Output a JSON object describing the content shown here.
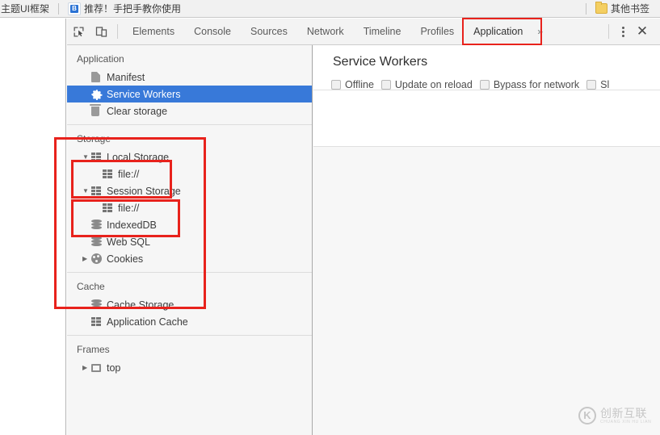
{
  "browser": {
    "bookmarks": [
      {
        "label": "主题UI框架",
        "icon": "none"
      },
      {
        "label": "推荐！手把手教你使用",
        "icon": "favicon-b"
      }
    ],
    "other_bookmarks_label": "其他书签",
    "folder_icon": "folder-icon"
  },
  "devtools": {
    "toolbar": {
      "inspect_icon": "inspect-element-icon",
      "device_icon": "device-toolbar-icon",
      "tabs": [
        {
          "label": "Elements",
          "active": false
        },
        {
          "label": "Console",
          "active": false
        },
        {
          "label": "Sources",
          "active": false
        },
        {
          "label": "Network",
          "active": false
        },
        {
          "label": "Timeline",
          "active": false
        },
        {
          "label": "Profiles",
          "active": false
        },
        {
          "label": "Application",
          "active": true
        }
      ],
      "overflow_label": "»",
      "more_icon": "kebab-menu-icon",
      "close_icon": "close-icon"
    },
    "sidebar": {
      "sections": [
        {
          "title": "Application",
          "items": [
            {
              "label": "Manifest",
              "icon": "document-icon",
              "arrow": "none",
              "indent": 1,
              "selected": false
            },
            {
              "label": "Service Workers",
              "icon": "gear-icon",
              "arrow": "none",
              "indent": 1,
              "selected": true
            },
            {
              "label": "Clear storage",
              "icon": "trash-icon",
              "arrow": "none",
              "indent": 1,
              "selected": false
            }
          ]
        },
        {
          "title": "Storage",
          "items": [
            {
              "label": "Local Storage",
              "icon": "table-icon",
              "arrow": "expanded",
              "indent": 1,
              "selected": false
            },
            {
              "label": "file://",
              "icon": "table-icon",
              "arrow": "none",
              "indent": 2,
              "selected": false
            },
            {
              "label": "Session Storage",
              "icon": "table-icon",
              "arrow": "expanded",
              "indent": 1,
              "selected": false
            },
            {
              "label": "file://",
              "icon": "table-icon",
              "arrow": "none",
              "indent": 2,
              "selected": false
            },
            {
              "label": "IndexedDB",
              "icon": "database-icon",
              "arrow": "none",
              "indent": 1,
              "selected": false
            },
            {
              "label": "Web SQL",
              "icon": "database-icon",
              "arrow": "none",
              "indent": 1,
              "selected": false
            },
            {
              "label": "Cookies",
              "icon": "cookie-icon",
              "arrow": "collapsed",
              "indent": 1,
              "selected": false
            }
          ]
        },
        {
          "title": "Cache",
          "items": [
            {
              "label": "Cache Storage",
              "icon": "database-icon",
              "arrow": "none",
              "indent": 1,
              "selected": false
            },
            {
              "label": "Application Cache",
              "icon": "table-icon",
              "arrow": "none",
              "indent": 1,
              "selected": false
            }
          ]
        },
        {
          "title": "Frames",
          "items": [
            {
              "label": "top",
              "icon": "frame-icon",
              "arrow": "collapsed",
              "indent": 1,
              "selected": false
            }
          ]
        }
      ]
    },
    "main": {
      "title": "Service Workers",
      "options": [
        {
          "label": "Offline",
          "checked": false
        },
        {
          "label": "Update on reload",
          "checked": false
        },
        {
          "label": "Bypass for network",
          "checked": false
        },
        {
          "label": "Sl",
          "checked": false
        }
      ]
    }
  },
  "annotations": {
    "accent_color": "#e8221c",
    "boxes": [
      {
        "name": "application-tab-highlight"
      },
      {
        "name": "storage-section-highlight"
      },
      {
        "name": "local-storage-highlight"
      },
      {
        "name": "session-storage-highlight"
      }
    ]
  },
  "watermark": {
    "cn": "创新互联",
    "en": "CHUANG XIN HU LIAN"
  }
}
